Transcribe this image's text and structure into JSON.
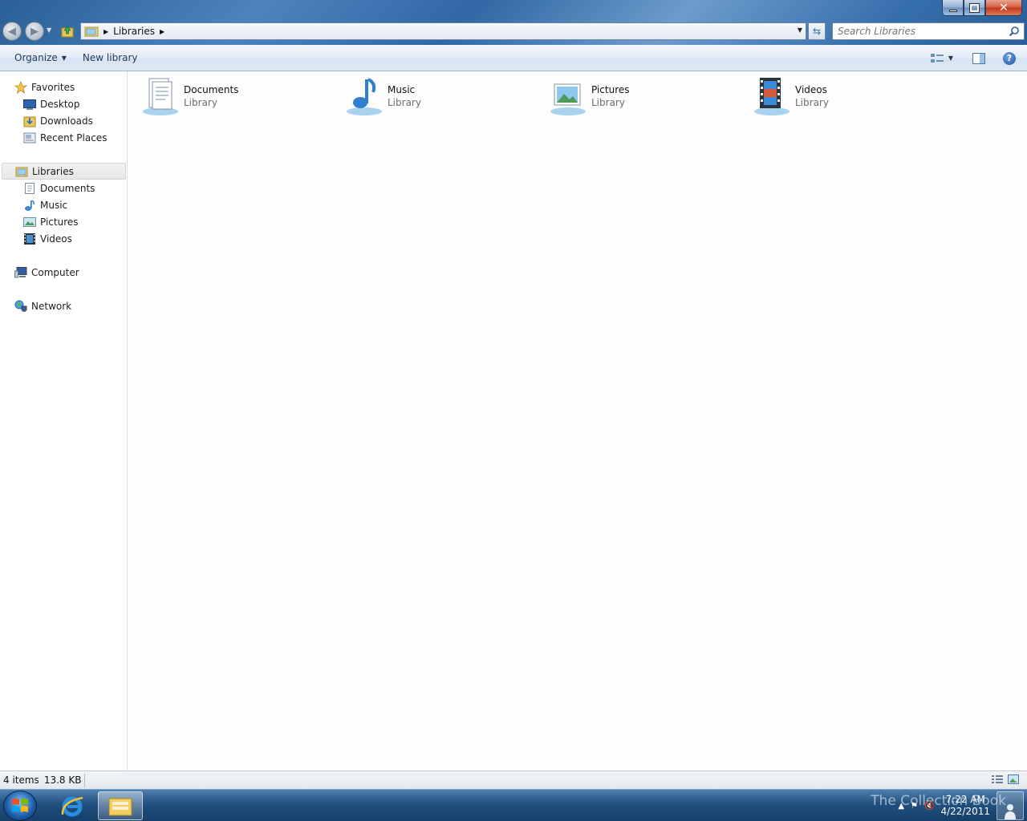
{
  "window": {
    "caption_close": "✕"
  },
  "address_bar": {
    "breadcrumb": [
      "Libraries"
    ]
  },
  "search": {
    "placeholder": "Search Libraries"
  },
  "toolbar": {
    "organize_label": "Organize",
    "new_library_label": "New library"
  },
  "navigation": {
    "favorites": {
      "label": "Favorites",
      "items": [
        {
          "label": "Desktop",
          "icon": "desktop-icon"
        },
        {
          "label": "Downloads",
          "icon": "downloads-icon"
        },
        {
          "label": "Recent Places",
          "icon": "recent-places-icon"
        }
      ]
    },
    "libraries": {
      "label": "Libraries",
      "items": [
        {
          "label": "Documents",
          "icon": "documents-icon"
        },
        {
          "label": "Music",
          "icon": "music-icon"
        },
        {
          "label": "Pictures",
          "icon": "pictures-icon"
        },
        {
          "label": "Videos",
          "icon": "videos-icon"
        }
      ]
    },
    "computer": {
      "label": "Computer"
    },
    "network": {
      "label": "Network"
    }
  },
  "content": {
    "libraries": [
      {
        "name": "Documents",
        "type": "Library",
        "icon": "documents-library-icon"
      },
      {
        "name": "Music",
        "type": "Library",
        "icon": "music-library-icon"
      },
      {
        "name": "Pictures",
        "type": "Library",
        "icon": "pictures-library-icon"
      },
      {
        "name": "Videos",
        "type": "Library",
        "icon": "videos-library-icon"
      }
    ]
  },
  "status": {
    "item_count": "4 items",
    "size": "13.8 KB"
  },
  "taskbar": {
    "apps": [
      "internet-explorer-icon",
      "windows-explorer-icon"
    ],
    "clock_time": "7:22 AM",
    "clock_date": "4/22/2011",
    "watermark": "The Collection Book"
  },
  "colors": {
    "accent": "#1e395b",
    "titlebar": "#2f68a3",
    "selection": "#e7e7e7"
  }
}
